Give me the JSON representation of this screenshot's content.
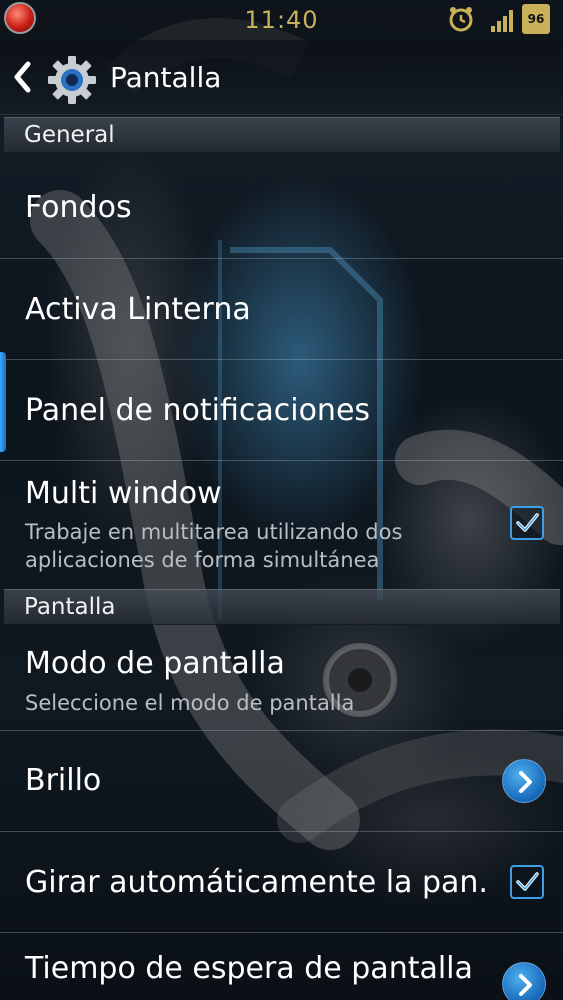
{
  "status_bar": {
    "time": "11:40",
    "battery_level": "96",
    "icons": [
      "notification-app-icon",
      "alarm-icon",
      "signal-icon",
      "battery-icon"
    ]
  },
  "action_bar": {
    "title": "Pantalla",
    "back_icon": "back-chevron-icon",
    "app_icon": "settings-gear-icon"
  },
  "sections": {
    "general": "General",
    "pantalla": "Pantalla"
  },
  "items": {
    "fondos": {
      "title": "Fondos"
    },
    "linterna": {
      "title": "Activa Linterna"
    },
    "panel": {
      "title": "Panel de notificaciones"
    },
    "multiwindow": {
      "title": "Multi window",
      "sub1": "Trabaje en multitarea utilizando dos",
      "sub2": "aplicaciones de forma simultánea",
      "checked": true
    },
    "modo": {
      "title": "Modo de pantalla",
      "sub": "Seleccione el modo de pantalla"
    },
    "brillo": {
      "title": "Brillo"
    },
    "girar": {
      "title": "Girar automáticamente la pan.",
      "checked": true
    },
    "tiempo": {
      "title": "Tiempo de espera de pantalla"
    }
  },
  "colors": {
    "accent": "#3da0e6",
    "time_text": "#c9b15a"
  }
}
